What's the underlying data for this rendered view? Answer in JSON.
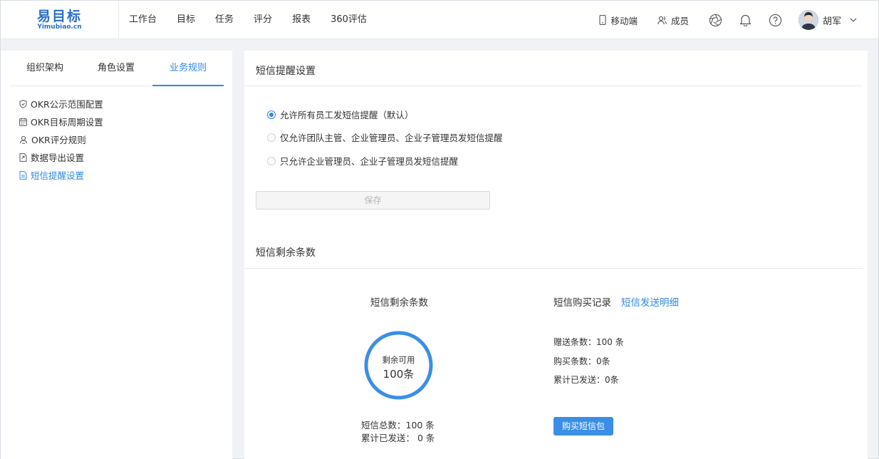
{
  "logo": {
    "cn": "易目标",
    "en": "Yimubiao.cn"
  },
  "nav": [
    "工作台",
    "目标",
    "任务",
    "评分",
    "报表",
    "360评估"
  ],
  "toolbar": {
    "mobile_label": "移动端",
    "members_label": "成员",
    "user_name": "胡军"
  },
  "left_tabs": [
    "组织架构",
    "角色设置",
    "业务规则"
  ],
  "menu": [
    {
      "label": "OKR公示范围配置",
      "icon": "shield-icon"
    },
    {
      "label": "OKR目标周期设置",
      "icon": "calendar-icon"
    },
    {
      "label": "OKR评分规则",
      "icon": "users-icon"
    },
    {
      "label": "数据导出设置",
      "icon": "export-icon"
    },
    {
      "label": "短信提醒设置",
      "icon": "document-icon"
    }
  ],
  "sms_settings": {
    "title": "短信提醒设置",
    "options": [
      "允许所有员工发短信提醒（默认）",
      "仅允许团队主管、企业管理员、企业子管理员发短信提醒",
      "只允许企业管理员、企业子管理员发短信提醒"
    ],
    "selected_index": 0,
    "save_label": "保存"
  },
  "sms_remaining": {
    "title": "短信剩余条数",
    "left_title": "短信剩余条数",
    "ring_label": "剩余可用",
    "ring_value": "100条",
    "ring_fraction": 1.0,
    "total_line": "短信总数：100 条",
    "sent_line": "累计已发送：  0 条",
    "records_title": "短信购买记录",
    "records_link": "短信发送明细",
    "gift_line": "赠送条数：100 条",
    "bought_line": "购买条数：0条",
    "sent_total_line": "累计已发送：0条",
    "buy_label": "购买短信包"
  },
  "colors": {
    "accent": "#2f88e6",
    "logo": "#2a6fc9"
  }
}
